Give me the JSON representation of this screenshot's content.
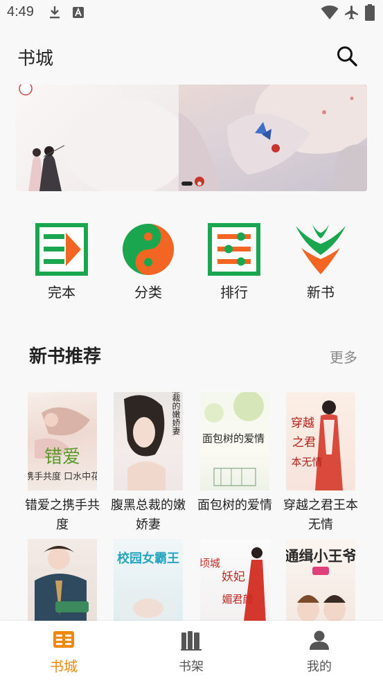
{
  "status_bar": {
    "time": "4:49"
  },
  "app_bar": {
    "title": "书城"
  },
  "colors": {
    "accent": "#f0880a",
    "green": "#1aa64e",
    "orange": "#f26522",
    "nav_inactive": "#555555"
  },
  "banner": {
    "slides": 2,
    "active_index": 0
  },
  "categories": [
    {
      "label": "完本",
      "icon": "finished-book-icon"
    },
    {
      "label": "分类",
      "icon": "yin-yang-category-icon"
    },
    {
      "label": "排行",
      "icon": "ranking-list-icon"
    },
    {
      "label": "新书",
      "icon": "new-book-leaf-icon"
    }
  ],
  "section": {
    "title": "新书推荐",
    "more": "更多"
  },
  "books": [
    {
      "title": "错爱之携手共度"
    },
    {
      "title": "腹黑总裁的嫩娇妻"
    },
    {
      "title": "面包树的爱情"
    },
    {
      "title": "穿越之君王本无情"
    },
    {
      "title": ""
    },
    {
      "title": ""
    },
    {
      "title": ""
    },
    {
      "title": ""
    }
  ],
  "bottom_nav": [
    {
      "label": "书城",
      "icon": "bookstore-icon",
      "active": true
    },
    {
      "label": "书架",
      "icon": "bookshelf-icon",
      "active": false
    },
    {
      "label": "我的",
      "icon": "profile-icon",
      "active": false
    }
  ]
}
